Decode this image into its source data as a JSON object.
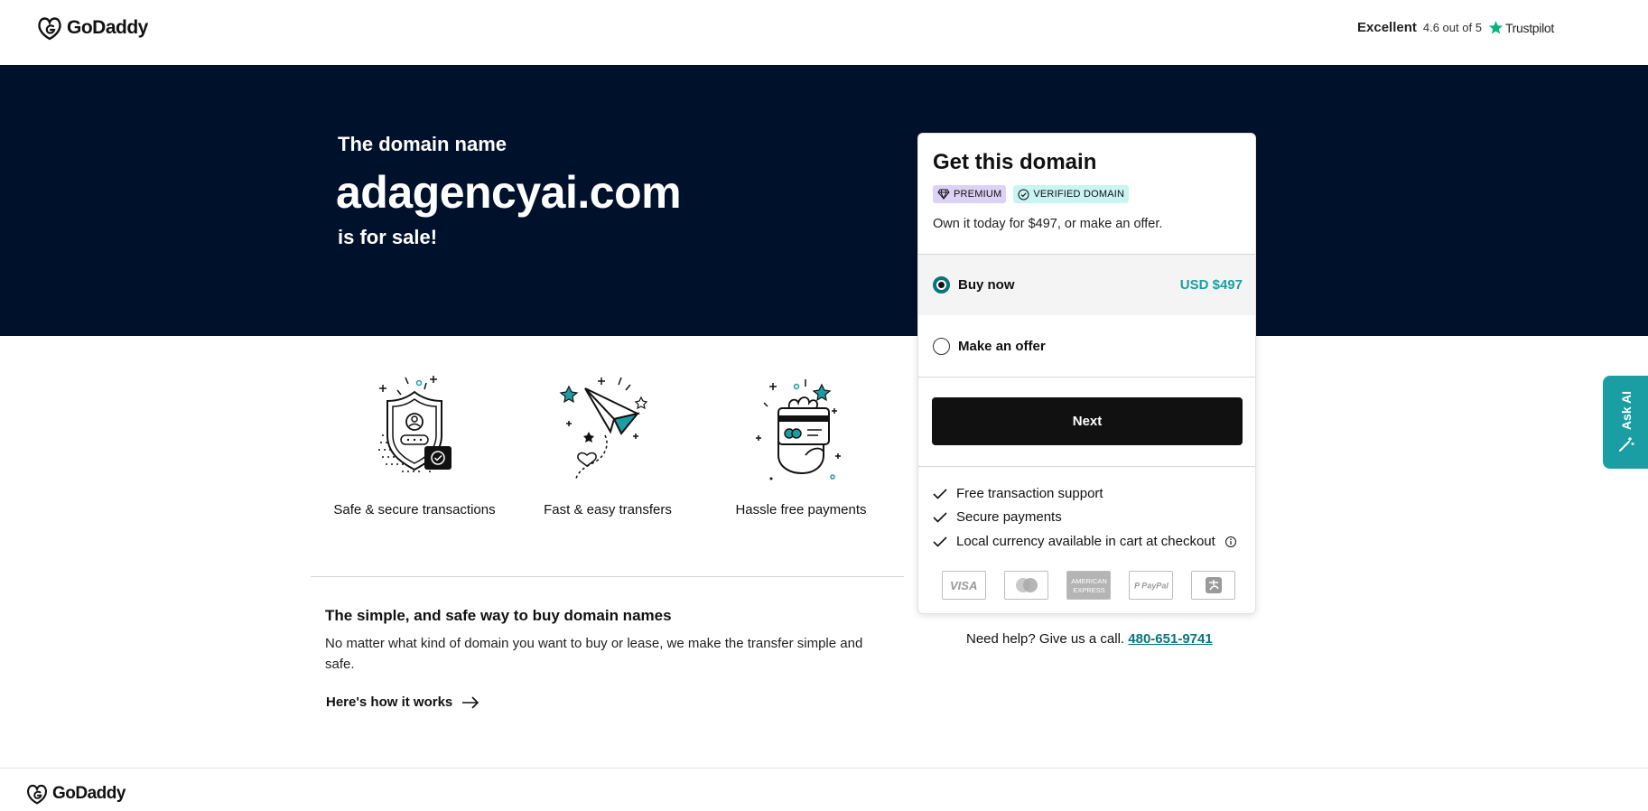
{
  "header": {
    "brand": "GoDaddy",
    "trustpilot": {
      "label": "Excellent",
      "rating_text": "4.6 out of 5",
      "brand": "Trustpilot",
      "star_color": "#00b67a"
    }
  },
  "hero": {
    "prefix": "The domain name",
    "domain": "adagencyai.com",
    "suffix": "is for sale!",
    "background_color": "#00112b"
  },
  "features": [
    {
      "icon": "shield-icon",
      "label": "Safe & secure transactions"
    },
    {
      "icon": "paper-plane-icon",
      "label": "Fast & easy transfers"
    },
    {
      "icon": "credit-card-hand-icon",
      "label": "Hassle free payments"
    }
  ],
  "info": {
    "title": "The simple, and safe way to buy domain names",
    "text": "No matter what kind of domain you want to buy or lease, we make the transfer simple and safe.",
    "link_label": "Here's how it works"
  },
  "card": {
    "title": "Get this domain",
    "badges": {
      "premium": "PREMIUM",
      "verified": "VERIFIED DOMAIN"
    },
    "subtitle": "Own it today for $497, or make an offer.",
    "options": {
      "buy_now": {
        "label": "Buy now",
        "price": "USD $497",
        "selected": true
      },
      "make_offer": {
        "label": "Make an offer",
        "selected": false
      }
    },
    "next_label": "Next",
    "benefits": [
      "Free transaction support",
      "Secure payments",
      "Local currency available in cart at checkout"
    ],
    "payment_methods": [
      "visa-icon",
      "mastercard-icon",
      "amex-icon",
      "paypal-icon",
      "alipay-icon"
    ]
  },
  "help": {
    "text": "Need help? Give us a call.",
    "phone": "480-651-9741"
  },
  "ask_ai": {
    "label": "Ask AI",
    "color": "#1a9ea3"
  },
  "footer": {
    "brand": "GoDaddy"
  },
  "colors": {
    "accent_teal": "#1a9ea3",
    "link_teal": "#09757a",
    "button_black": "#111111"
  }
}
